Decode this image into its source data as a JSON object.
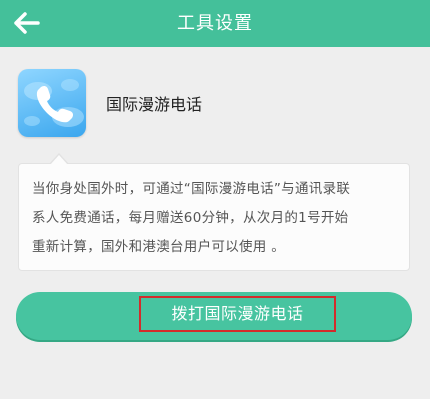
{
  "header": {
    "title": "工具设置",
    "back_icon": "arrow-left-icon"
  },
  "tool": {
    "icon": "phone-icon",
    "name": "国际漫游电话"
  },
  "description": {
    "lines": [
      "当你身处国外时，可通过“国际漫游电话”与通讯录联",
      "系人免费通话，每月赠送60分钟，从次月的1号开始",
      "重新计算，国外和港澳台用户可以使用 。"
    ]
  },
  "action": {
    "dial_label": "拨打国际漫游电话"
  },
  "colors": {
    "header_bg": "#44c09a",
    "button_bg": "#47c4a0",
    "highlight_border": "#d32b2b",
    "icon_blue": "#3aa6ee"
  }
}
